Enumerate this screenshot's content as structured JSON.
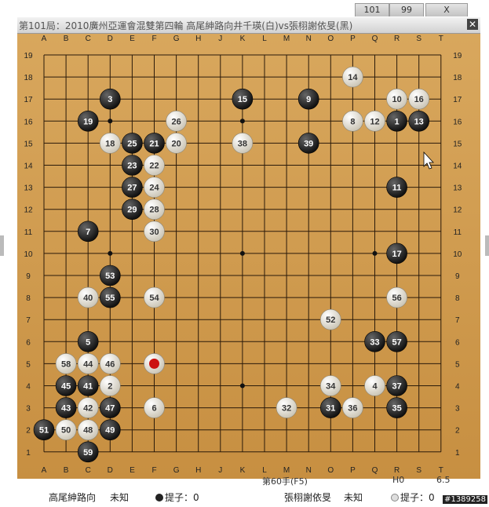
{
  "tabs": [
    "101",
    "99",
    "X"
  ],
  "title": "第101局：2010廣州亞運會混雙第四輪 高尾紳路向井千瑛(白)vs張栩謝依旻(黑)",
  "close_icon": "close-icon",
  "board": {
    "size": 19,
    "columns": [
      "A",
      "B",
      "C",
      "D",
      "E",
      "F",
      "G",
      "H",
      "J",
      "K",
      "L",
      "M",
      "N",
      "O",
      "P",
      "Q",
      "R",
      "S",
      "T"
    ],
    "rows_top_to_bottom": [
      "19",
      "18",
      "17",
      "16",
      "15",
      "14",
      "13",
      "12",
      "11",
      "10",
      "9",
      "8",
      "7",
      "6",
      "5",
      "4",
      "3",
      "2",
      "1"
    ],
    "star_points": [
      [
        4,
        4
      ],
      [
        10,
        4
      ],
      [
        16,
        4
      ],
      [
        4,
        10
      ],
      [
        10,
        10
      ],
      [
        16,
        10
      ],
      [
        4,
        16
      ],
      [
        10,
        16
      ],
      [
        16,
        16
      ]
    ],
    "last_move_marker": {
      "col": 6,
      "row": 5,
      "color": "#cc1111"
    },
    "stones": [
      {
        "n": 1,
        "c": "b",
        "col": 17,
        "row": 16
      },
      {
        "n": 2,
        "c": "w",
        "col": 4,
        "row": 4
      },
      {
        "n": 3,
        "c": "b",
        "col": 4,
        "row": 17
      },
      {
        "n": 4,
        "c": "w",
        "col": 16,
        "row": 4
      },
      {
        "n": 5,
        "c": "b",
        "col": 3,
        "row": 6
      },
      {
        "n": 6,
        "c": "w",
        "col": 6,
        "row": 3
      },
      {
        "n": 7,
        "c": "b",
        "col": 3,
        "row": 11
      },
      {
        "n": 8,
        "c": "w",
        "col": 15,
        "row": 16
      },
      {
        "n": 9,
        "c": "b",
        "col": 13,
        "row": 17
      },
      {
        "n": 10,
        "c": "w",
        "col": 17,
        "row": 17
      },
      {
        "n": 11,
        "c": "b",
        "col": 17,
        "row": 13
      },
      {
        "n": 12,
        "c": "w",
        "col": 16,
        "row": 16
      },
      {
        "n": 13,
        "c": "b",
        "col": 18,
        "row": 16
      },
      {
        "n": 14,
        "c": "w",
        "col": 15,
        "row": 18
      },
      {
        "n": 15,
        "c": "b",
        "col": 10,
        "row": 17
      },
      {
        "n": 16,
        "c": "w",
        "col": 18,
        "row": 17
      },
      {
        "n": 17,
        "c": "b",
        "col": 17,
        "row": 10
      },
      {
        "n": 18,
        "c": "w",
        "col": 4,
        "row": 15
      },
      {
        "n": 19,
        "c": "b",
        "col": 3,
        "row": 16
      },
      {
        "n": 20,
        "c": "w",
        "col": 7,
        "row": 15
      },
      {
        "n": 21,
        "c": "b",
        "col": 6,
        "row": 15
      },
      {
        "n": 22,
        "c": "w",
        "col": 6,
        "row": 14
      },
      {
        "n": 23,
        "c": "b",
        "col": 5,
        "row": 14
      },
      {
        "n": 24,
        "c": "w",
        "col": 6,
        "row": 13
      },
      {
        "n": 25,
        "c": "b",
        "col": 5,
        "row": 15
      },
      {
        "n": 26,
        "c": "w",
        "col": 7,
        "row": 16
      },
      {
        "n": 27,
        "c": "b",
        "col": 5,
        "row": 13
      },
      {
        "n": 28,
        "c": "w",
        "col": 6,
        "row": 12
      },
      {
        "n": 29,
        "c": "b",
        "col": 5,
        "row": 12
      },
      {
        "n": 30,
        "c": "w",
        "col": 6,
        "row": 11
      },
      {
        "n": 31,
        "c": "b",
        "col": 14,
        "row": 3
      },
      {
        "n": 32,
        "c": "w",
        "col": 12,
        "row": 3
      },
      {
        "n": 33,
        "c": "b",
        "col": 16,
        "row": 6
      },
      {
        "n": 34,
        "c": "w",
        "col": 14,
        "row": 4
      },
      {
        "n": 35,
        "c": "b",
        "col": 17,
        "row": 3
      },
      {
        "n": 36,
        "c": "w",
        "col": 15,
        "row": 3
      },
      {
        "n": 37,
        "c": "b",
        "col": 17,
        "row": 4
      },
      {
        "n": 38,
        "c": "w",
        "col": 10,
        "row": 15
      },
      {
        "n": 39,
        "c": "b",
        "col": 13,
        "row": 15
      },
      {
        "n": 40,
        "c": "w",
        "col": 3,
        "row": 8
      },
      {
        "n": 41,
        "c": "b",
        "col": 3,
        "row": 4
      },
      {
        "n": 42,
        "c": "w",
        "col": 3,
        "row": 3
      },
      {
        "n": 43,
        "c": "b",
        "col": 2,
        "row": 3
      },
      {
        "n": 44,
        "c": "w",
        "col": 3,
        "row": 5
      },
      {
        "n": 45,
        "c": "b",
        "col": 2,
        "row": 4
      },
      {
        "n": 46,
        "c": "w",
        "col": 4,
        "row": 5
      },
      {
        "n": 47,
        "c": "b",
        "col": 4,
        "row": 3
      },
      {
        "n": 48,
        "c": "w",
        "col": 3,
        "row": 2
      },
      {
        "n": 49,
        "c": "b",
        "col": 4,
        "row": 2
      },
      {
        "n": 50,
        "c": "w",
        "col": 2,
        "row": 2
      },
      {
        "n": 51,
        "c": "b",
        "col": 1,
        "row": 2
      },
      {
        "n": 52,
        "c": "w",
        "col": 14,
        "row": 7
      },
      {
        "n": 53,
        "c": "b",
        "col": 4,
        "row": 9
      },
      {
        "n": 54,
        "c": "w",
        "col": 6,
        "row": 8
      },
      {
        "n": 55,
        "c": "b",
        "col": 4,
        "row": 8
      },
      {
        "n": 56,
        "c": "w",
        "col": 17,
        "row": 8
      },
      {
        "n": 57,
        "c": "b",
        "col": 17,
        "row": 6
      },
      {
        "n": 58,
        "c": "w",
        "col": 2,
        "row": 5
      },
      {
        "n": 59,
        "c": "b",
        "col": 3,
        "row": 1
      },
      {
        "n": 60,
        "c": "b",
        "col": 6,
        "row": 5
      }
    ]
  },
  "status": {
    "move": "第60手(F5)",
    "h0": "H0",
    "komi": "6.5"
  },
  "players": {
    "white_name": "高尾紳路向",
    "white_rank": "未知",
    "white_captures_label": "提子：0",
    "black_name": "張栩謝依旻",
    "black_rank": "未知",
    "black_captures_label": "提子：0"
  },
  "watermark": "#1389258",
  "colors": {
    "board": "#d9a85e",
    "black_stone": "#111111",
    "white_stone": "#f2f2f2"
  }
}
